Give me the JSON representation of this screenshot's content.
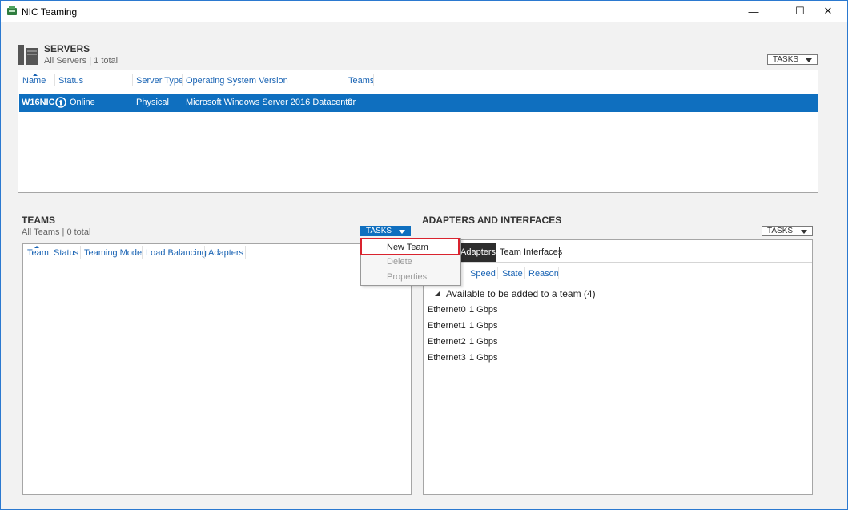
{
  "window": {
    "title": "NIC Teaming",
    "minimize": "—",
    "maximize": "☐",
    "close": "✕"
  },
  "servers": {
    "title": "SERVERS",
    "subtitle": "All Servers | 1 total",
    "tasks_label": "TASKS",
    "columns": [
      "Name",
      "Status",
      "Server Type",
      "Operating System Version",
      "Teams"
    ],
    "rows": [
      {
        "name": "W16NIC",
        "status": "Online",
        "server_type": "Physical",
        "os": "Microsoft Windows Server 2016 Datacenter",
        "teams": "0"
      }
    ]
  },
  "teams": {
    "title": "TEAMS",
    "subtitle": "All Teams | 0 total",
    "tasks_label": "TASKS",
    "columns": [
      "Team",
      "Status",
      "Teaming Mode",
      "Load Balancing",
      "Adapters"
    ],
    "menu": [
      "New Team",
      "Delete",
      "Properties"
    ]
  },
  "adapters": {
    "title": "ADAPTERS AND INTERFACES",
    "tasks_label": "TASKS",
    "tabs": [
      "Adapters",
      "Team Interfaces"
    ],
    "columns": [
      "Speed",
      "State",
      "Reason"
    ],
    "group_label": "Available to be added to a team (4)",
    "rows": [
      {
        "name": "Ethernet0",
        "speed": "1 Gbps"
      },
      {
        "name": "Ethernet1",
        "speed": "1 Gbps"
      },
      {
        "name": "Ethernet2",
        "speed": "1 Gbps"
      },
      {
        "name": "Ethernet3",
        "speed": "1 Gbps"
      }
    ]
  },
  "colors": {
    "accent": "#0f6fbf",
    "link": "#1a64b4",
    "menu_highlight_border": "#d9232e",
    "tab_active": "#2d2d2d"
  }
}
